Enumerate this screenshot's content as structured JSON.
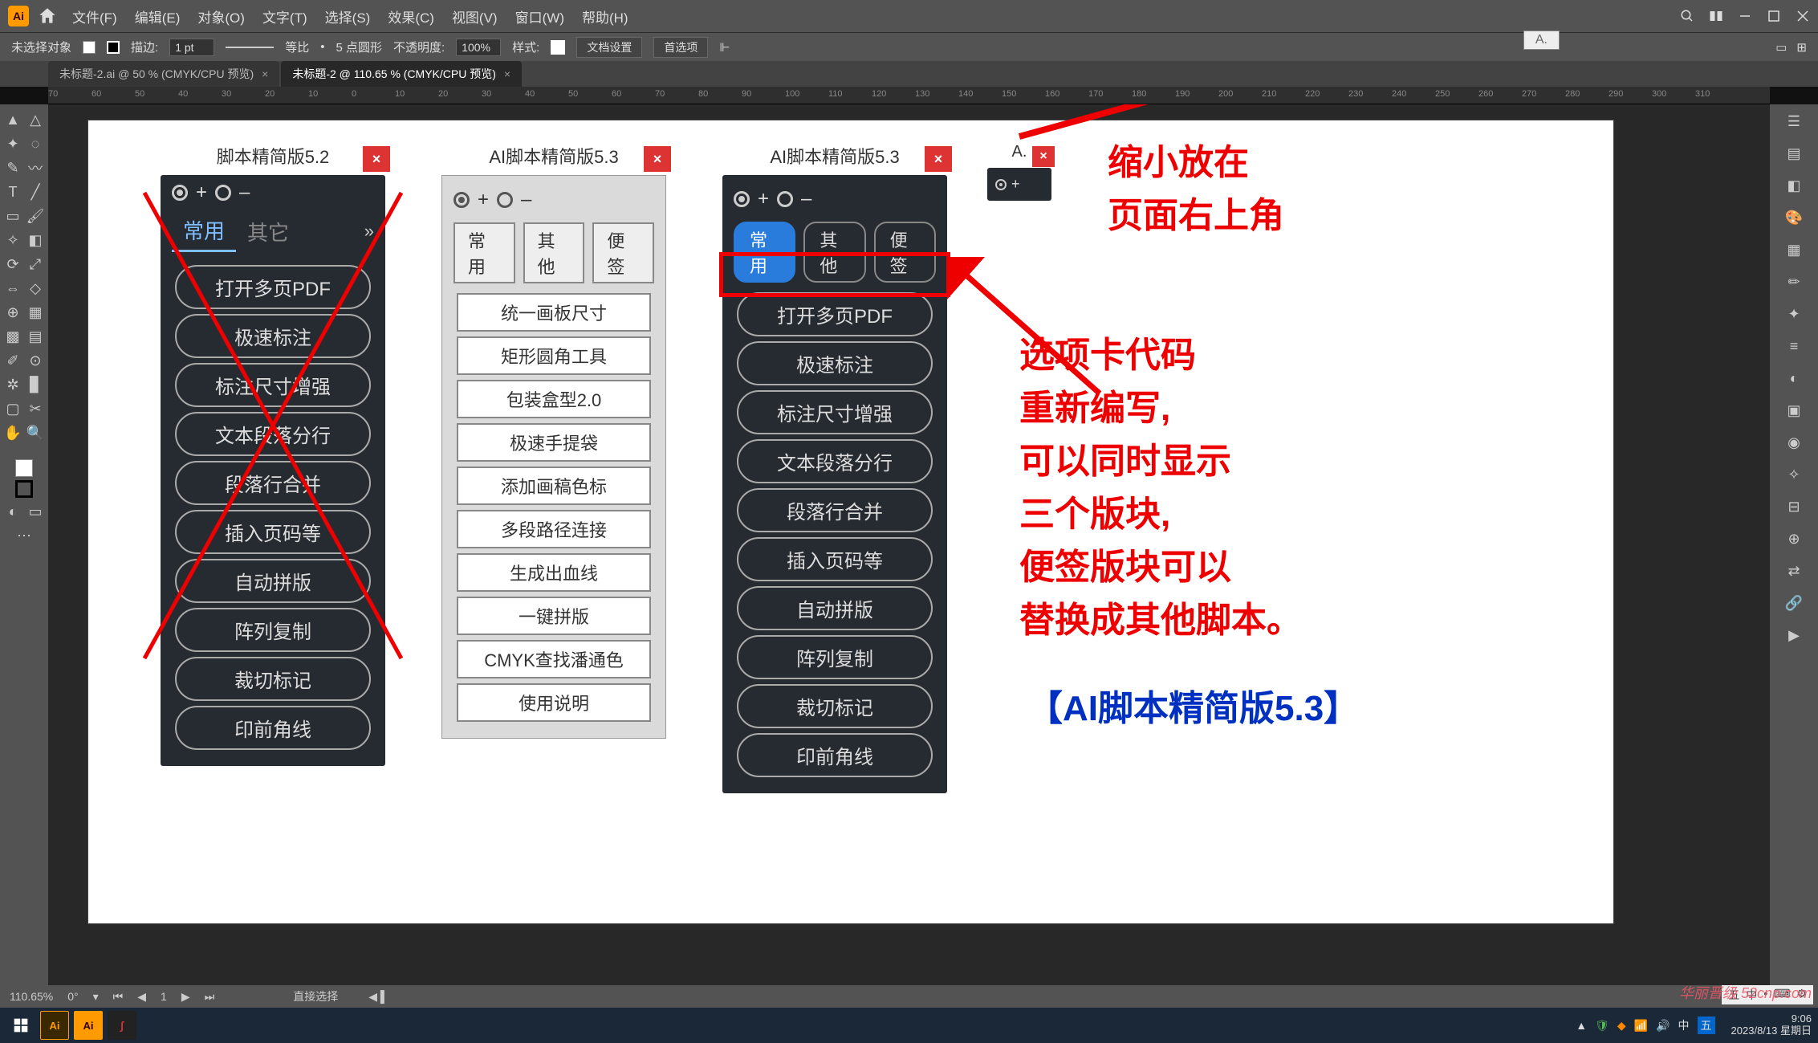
{
  "menubar": {
    "items": [
      "文件(F)",
      "编辑(E)",
      "对象(O)",
      "文字(T)",
      "选择(S)",
      "效果(C)",
      "视图(V)",
      "窗口(W)",
      "帮助(H)"
    ]
  },
  "optbar": {
    "noSelection": "未选择对象",
    "strokeLabel": "描边:",
    "strokeVal": "1 pt",
    "uniformLabel": "等比",
    "profileLabel": "5 点圆形",
    "opacityLabel": "不透明度:",
    "opacityVal": "100%",
    "styleLabel": "样式:",
    "docSetup": "文档设置",
    "prefs": "首选项"
  },
  "doctabs": {
    "tab1": "未标题-2.ai @ 50 % (CMYK/CPU 预览)",
    "tab2": "未标题-2 @ 110.65 % (CMYK/CPU 预览)"
  },
  "ruler": {
    "ticks": [
      "70",
      "60",
      "50",
      "40",
      "30",
      "20",
      "10",
      "0",
      "10",
      "20",
      "30",
      "40",
      "50",
      "60",
      "70",
      "80",
      "90",
      "100",
      "110",
      "120",
      "130",
      "140",
      "150",
      "160",
      "170",
      "180",
      "190",
      "200",
      "210",
      "220",
      "230",
      "240",
      "250",
      "260",
      "270",
      "280",
      "290",
      "300",
      "310"
    ]
  },
  "panel52": {
    "title": "脚本精简版5.2",
    "tabs": [
      "常用",
      "其它"
    ],
    "buttons": [
      "打开多页PDF",
      "极速标注",
      "标注尺寸增强",
      "文本段落分行",
      "段落行合并",
      "插入页码等",
      "自动拼版",
      "阵列复制",
      "裁切标记",
      "印前角线"
    ]
  },
  "panel53light": {
    "title": "AI脚本精简版5.3",
    "tabs": [
      "常用",
      "其他",
      "便签"
    ],
    "buttons": [
      "统一画板尺寸",
      "矩形圆角工具",
      "包装盒型2.0",
      "极速手提袋",
      "添加画稿色标",
      "多段路径连接",
      "生成出血线",
      "一键拼版",
      "CMYK查找潘通色",
      "使用说明"
    ]
  },
  "panel53dark": {
    "title": "AI脚本精简版5.3",
    "tabs": [
      "常用",
      "其他",
      "便签"
    ],
    "buttons": [
      "打开多页PDF",
      "极速标注",
      "标注尺寸增强",
      "文本段落分行",
      "段落行合并",
      "插入页码等",
      "自动拼版",
      "阵列复制",
      "裁切标记",
      "印前角线"
    ]
  },
  "mini": {
    "label": "A."
  },
  "floater": {
    "label": "A."
  },
  "anno": {
    "top1": "缩小放在",
    "top2": "页面右上角",
    "mid": [
      "选项卡代码",
      "重新编写,",
      "可以同时显示",
      "三个版块,",
      "便签版块可以",
      "替换成其他脚本。"
    ],
    "bottom": "【AI脚本精简版5.3】"
  },
  "status": {
    "zoom": "110.65%",
    "info": "直接选择"
  },
  "taskbar": {
    "time": "9:06",
    "date": "2023/8/13 星期日"
  },
  "watermark": "华丽晋级 52cnp.com"
}
